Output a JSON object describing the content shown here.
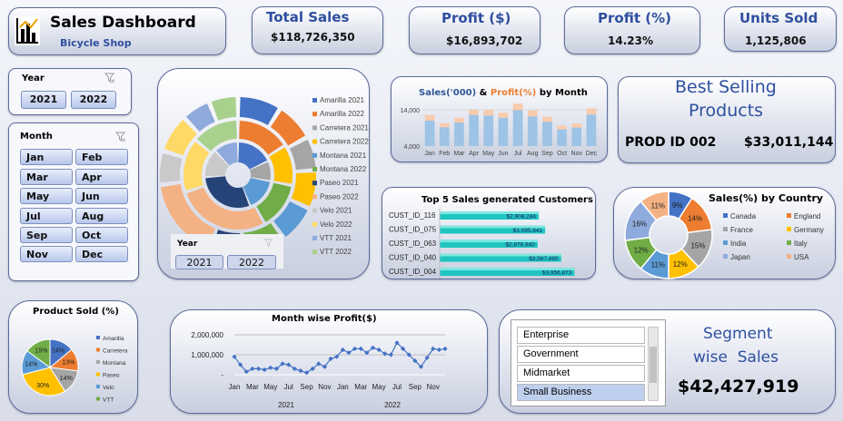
{
  "header": {
    "title": "Sales Dashboard",
    "subtitle": "Bicycle Shop"
  },
  "kpis": [
    {
      "label": "Total Sales",
      "value": "$118,726,350"
    },
    {
      "label": "Profit ($)",
      "value": "$16,893,702"
    },
    {
      "label": "Profit (%)",
      "value": "14.23%"
    },
    {
      "label": "Units Sold",
      "value": "1,125,806"
    }
  ],
  "year_slicer": {
    "label": "Year",
    "options": [
      "2021",
      "2022"
    ]
  },
  "month_slicer": {
    "label": "Month",
    "options": [
      "Jan",
      "Feb",
      "Mar",
      "Apr",
      "May",
      "Jun",
      "Jul",
      "Aug",
      "Sep",
      "Oct",
      "Nov",
      "Dec"
    ]
  },
  "best_selling": {
    "title_line1": "Best Selling",
    "title_line2": "Products",
    "product": "PROD ID 002",
    "amount": "$33,011,144"
  },
  "segment": {
    "options": [
      "Enterprise",
      "Government",
      "Midmarket",
      "Small Business"
    ],
    "selected": "Small Business",
    "title_line1": "Segment",
    "title_line2": "wise  Sales",
    "value": "$42,427,919"
  },
  "colors": {
    "accent": "#2f4f9f",
    "bar": "#9dc3e6",
    "bar_top": "#f8cbad",
    "line": "#4472c4"
  },
  "chart_data": [
    {
      "type": "pie",
      "subtype": "multi-ring doughnut",
      "legend_position": "right",
      "legend": [
        "Amarilla 2021",
        "Amarilla 2022",
        "Carretera 2021",
        "Carretera 2022",
        "Montana 2021",
        "Montana 2022",
        "Paseo 2021",
        "Paseo 2022",
        "Velo 2021",
        "Velo 2022",
        "VTT 2021",
        "VTT 2022"
      ],
      "legend_colors": [
        "#4472c4",
        "#ed7d31",
        "#a5a5a5",
        "#ffc000",
        "#5b9bd5",
        "#70ad47",
        "#264478",
        "#f4b183",
        "#c9c9c9",
        "#ffd966",
        "#8faadc",
        "#a9d18e"
      ],
      "slicer": {
        "label": "Year",
        "options": [
          "2021",
          "2022"
        ]
      }
    },
    {
      "type": "bar",
      "title_part1": "Sales('000)",
      "title_amp": " & ",
      "title_part2": "Profit(%)",
      "title_part3": " by Month",
      "categories": [
        "Jan",
        "Feb",
        "Mar",
        "Apr",
        "May",
        "Jun",
        "Jul",
        "Aug",
        "Sep",
        "Oct",
        "Nov",
        "Dec"
      ],
      "series": [
        {
          "values": [
            11000,
            9200,
            10500,
            12600,
            12400,
            11800,
            13900,
            12200,
            10700,
            8600,
            9100,
            12700
          ]
        },
        {
          "values": [
            1600,
            1100,
            1300,
            1400,
            1600,
            1400,
            1800,
            1600,
            1400,
            1000,
            1100,
            1700
          ]
        }
      ],
      "yticks": [
        "4,000",
        "14,000"
      ],
      "ylim": [
        4000,
        16000
      ]
    },
    {
      "type": "bar",
      "orientation": "horizontal",
      "title": "Top 5 Sales generated Customers",
      "categories": [
        "CUST_ID_116",
        "CUST_ID_075",
        "CUST_ID_063",
        "CUST_ID_040",
        "CUST_ID_004"
      ],
      "values": [
        2908284,
        3095841,
        2876940,
        3567885,
        3956873
      ],
      "labels": [
        "$2,908,284",
        "$3,095,841",
        "$2,876,940",
        "$3,567,885",
        "$3,956,873"
      ]
    },
    {
      "type": "pie",
      "subtype": "doughnut",
      "title": "Sales(%) by Country",
      "legend_position": "right",
      "categories": [
        "Canada",
        "England",
        "France",
        "Germany",
        "India",
        "Italy",
        "Japan",
        "USA"
      ],
      "values": [
        9,
        14,
        15,
        12,
        11,
        12,
        16,
        11
      ],
      "labels": [
        "9%",
        "14%",
        "15%",
        "12%",
        "11%",
        "12%",
        "16%",
        "11%"
      ],
      "colors": [
        "#4472c4",
        "#ed7d31",
        "#a5a5a5",
        "#ffc000",
        "#5b9bd5",
        "#70ad47",
        "#8faadc",
        "#f4b183"
      ]
    },
    {
      "type": "pie",
      "title": "Product Sold (%)",
      "legend_position": "right",
      "categories": [
        "Amarilla",
        "Carretera",
        "Montana",
        "Paseo",
        "Velo",
        "VTT"
      ],
      "values": [
        14,
        13,
        14,
        30,
        14,
        15
      ],
      "labels": [
        "14%",
        "13%",
        "14%",
        "30%",
        "14%",
        "15%"
      ],
      "colors": [
        "#4472c4",
        "#ed7d31",
        "#a5a5a5",
        "#ffc000",
        "#5b9bd5",
        "#70ad47"
      ]
    },
    {
      "type": "line",
      "title": "Month wise Profit($)",
      "x_ticks": [
        "Jan",
        "Mar",
        "May",
        "Jul",
        "Sep",
        "Nov",
        "Jan",
        "Mar",
        "May",
        "Jul",
        "Sep",
        "Nov"
      ],
      "year_labels": [
        "2021",
        "2022"
      ],
      "values": [
        900000,
        500000,
        150000,
        300000,
        300000,
        250000,
        350000,
        300000,
        550000,
        500000,
        300000,
        200000,
        100000,
        300000,
        550000,
        400000,
        800000,
        900000,
        1250000,
        1100000,
        1300000,
        1300000,
        1100000,
        1350000,
        1250000,
        1050000,
        1000000,
        1600000,
        1300000,
        1000000,
        700000,
        400000,
        850000,
        1300000,
        1250000,
        1300000
      ],
      "yticks": [
        "2,000,000",
        "1,000,000",
        "-"
      ],
      "ylim": [
        0,
        2000000
      ]
    }
  ]
}
